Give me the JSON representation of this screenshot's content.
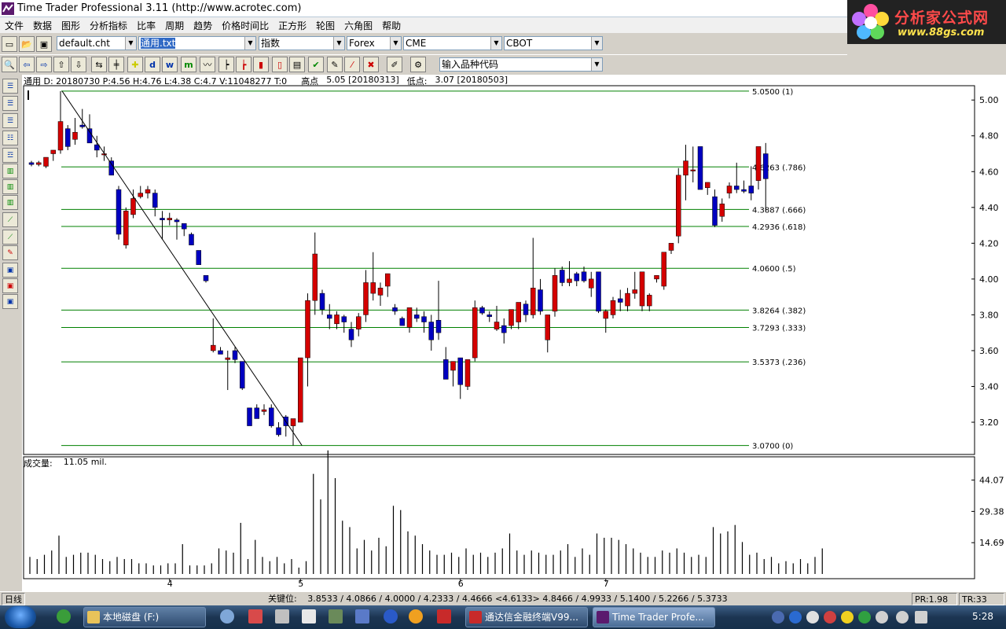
{
  "window": {
    "title": "Time Trader Professional 3.11 (http://www.acrotec.com)"
  },
  "logo": {
    "text": "分析家公式网",
    "url": "www.88gs.com"
  },
  "menu": [
    "文件",
    "数据",
    "图形",
    "分析指标",
    "比率",
    "周期",
    "趋势",
    "价格时间比",
    "正方形",
    "轮图",
    "六角图",
    "帮助"
  ],
  "toolbar": {
    "chart_file": "default.cht",
    "data_file": "通用.txt",
    "index": "指数",
    "market": "Forex",
    "exchange1": "CME",
    "exchange2": "CBOT",
    "symbol_placeholder": "输入品种代码"
  },
  "info": {
    "quote": "通用  D: 20180730  P:4.56  H:4.76  L:4.38  C:4.7  V:11048277  T:0",
    "high_label": "高点",
    "high_value": "5.05 [20180313]",
    "low_label": "低点:",
    "low_value": "3.07 [20180503]"
  },
  "volume": {
    "label": "成交量:",
    "value": "11.05 mil."
  },
  "status": {
    "period": "日线",
    "key_label": "关键位:",
    "key_values": "3.8533 / 4.0866 / 4.0000 / 4.2333 / 4.4666 <4.6133> 4.8466 / 4.9933 / 5.1400 / 5.2266 / 5.3733",
    "pr": "PR:1.98",
    "tr": "TR:33"
  },
  "taskbar": {
    "items": [
      "本地磁盘 (F:)",
      "通达信金融终端V99...",
      "Time Trader Profe..."
    ],
    "clock": "5:28"
  },
  "chart_data": {
    "type": "candlestick",
    "price_axis": {
      "ylim": [
        3.02,
        5.08
      ],
      "ticks": [
        "5.00",
        "4.80",
        "4.60",
        "4.40",
        "4.20",
        "4.00",
        "3.80",
        "3.60",
        "3.40",
        "3.20"
      ]
    },
    "volume_axis": {
      "ylim": [
        0,
        55
      ],
      "ticks": [
        "44.07",
        "29.38",
        "14.69"
      ]
    },
    "x_labels": [
      {
        "label": "4",
        "index": 19
      },
      {
        "label": "5",
        "index": 37
      },
      {
        "label": "6",
        "index": 59
      },
      {
        "label": "7",
        "index": 79
      }
    ],
    "fib_levels": [
      {
        "price": 5.05,
        "label": "5.0500  (1)"
      },
      {
        "price": 4.6263,
        "label": "4.6263  (.786)"
      },
      {
        "price": 4.3887,
        "label": "4.3887  (.666)"
      },
      {
        "price": 4.2936,
        "label": "4.2936  (.618)"
      },
      {
        "price": 4.06,
        "label": "4.0600  (.5)"
      },
      {
        "price": 3.8264,
        "label": "3.8264  (.382)"
      },
      {
        "price": 3.7293,
        "label": "3.7293  (.333)"
      },
      {
        "price": 3.5373,
        "label": "3.5373  (.236)"
      },
      {
        "price": 3.07,
        "label": "3.0700  (0)"
      }
    ],
    "trendline": {
      "from_index": 4,
      "from_price": 5.05,
      "to_index": 37,
      "to_price": 3.07
    },
    "candles": [
      [
        4.65,
        4.66,
        4.63,
        4.64
      ],
      [
        4.64,
        4.66,
        4.63,
        4.65
      ],
      [
        4.63,
        4.68,
        4.62,
        4.68
      ],
      [
        4.7,
        4.72,
        4.66,
        4.72
      ],
      [
        4.72,
        5.05,
        4.7,
        4.88
      ],
      [
        4.84,
        4.86,
        4.72,
        4.74
      ],
      [
        4.78,
        4.9,
        4.75,
        4.82
      ],
      [
        4.86,
        4.95,
        4.84,
        4.85
      ],
      [
        4.84,
        4.92,
        4.76,
        4.76
      ],
      [
        4.75,
        4.8,
        4.68,
        4.72
      ],
      [
        4.7,
        4.74,
        4.66,
        4.7
      ],
      [
        4.66,
        4.68,
        4.58,
        4.58
      ],
      [
        4.5,
        4.52,
        4.22,
        4.25
      ],
      [
        4.19,
        4.4,
        4.17,
        4.38
      ],
      [
        4.36,
        4.5,
        4.34,
        4.45
      ],
      [
        4.46,
        4.52,
        4.45,
        4.48
      ],
      [
        4.48,
        4.52,
        4.45,
        4.5
      ],
      [
        4.48,
        4.5,
        4.35,
        4.4
      ],
      [
        4.34,
        4.38,
        4.22,
        4.33
      ],
      [
        4.33,
        4.37,
        4.3,
        4.34
      ],
      [
        4.33,
        4.34,
        4.22,
        4.32
      ],
      [
        4.31,
        4.31,
        4.24,
        4.28
      ],
      [
        4.25,
        4.26,
        4.19,
        4.19
      ],
      [
        4.16,
        4.16,
        4.08,
        4.08
      ],
      [
        4.02,
        4.02,
        3.98,
        3.99
      ],
      [
        3.6,
        3.78,
        3.59,
        3.63
      ],
      [
        3.6,
        3.62,
        3.58,
        3.58
      ],
      [
        3.55,
        3.6,
        3.38,
        3.56
      ],
      [
        3.6,
        3.62,
        3.53,
        3.55
      ],
      [
        3.54,
        3.54,
        3.38,
        3.39
      ],
      [
        3.28,
        3.28,
        3.22,
        3.18
      ],
      [
        3.28,
        3.3,
        3.22,
        3.22
      ],
      [
        3.26,
        3.3,
        3.24,
        3.27
      ],
      [
        3.28,
        3.3,
        3.17,
        3.18
      ],
      [
        3.17,
        3.2,
        3.12,
        3.13
      ],
      [
        3.23,
        3.24,
        3.12,
        3.18
      ],
      [
        3.18,
        3.2,
        3.07,
        3.22
      ],
      [
        3.2,
        3.55,
        3.2,
        3.56
      ],
      [
        3.56,
        3.92,
        3.4,
        3.88
      ],
      [
        3.88,
        4.26,
        3.8,
        4.14
      ],
      [
        3.92,
        3.94,
        3.8,
        3.83
      ],
      [
        3.8,
        3.86,
        3.72,
        3.78
      ],
      [
        3.75,
        3.82,
        3.72,
        3.8
      ],
      [
        3.79,
        3.8,
        3.7,
        3.76
      ],
      [
        3.72,
        3.76,
        3.62,
        3.66
      ],
      [
        3.72,
        3.81,
        3.68,
        3.79
      ],
      [
        3.8,
        4.05,
        3.76,
        3.98
      ],
      [
        3.92,
        4.15,
        3.88,
        3.98
      ],
      [
        3.91,
        3.98,
        3.85,
        3.95
      ],
      [
        3.96,
        4.03,
        3.9,
        4.03
      ],
      [
        3.84,
        3.86,
        3.8,
        3.82
      ],
      [
        3.78,
        3.79,
        3.74,
        3.74
      ],
      [
        3.73,
        3.8,
        3.7,
        3.84
      ],
      [
        3.8,
        3.84,
        3.76,
        3.78
      ],
      [
        3.79,
        3.82,
        3.7,
        3.76
      ],
      [
        3.76,
        3.8,
        3.6,
        3.66
      ],
      [
        3.77,
        3.99,
        3.66,
        3.7
      ],
      [
        3.55,
        3.62,
        3.44,
        3.44
      ],
      [
        3.49,
        3.52,
        3.4,
        3.54
      ],
      [
        3.56,
        3.56,
        3.33,
        3.41
      ],
      [
        3.4,
        3.54,
        3.38,
        3.55
      ],
      [
        3.56,
        3.88,
        3.54,
        3.84
      ],
      [
        3.84,
        3.85,
        3.8,
        3.81
      ],
      [
        3.8,
        3.82,
        3.76,
        3.79
      ],
      [
        3.72,
        3.85,
        3.71,
        3.76
      ],
      [
        3.74,
        3.78,
        3.64,
        3.7
      ],
      [
        3.74,
        3.8,
        3.72,
        3.83
      ],
      [
        3.76,
        3.82,
        3.72,
        3.87
      ],
      [
        3.86,
        3.88,
        3.76,
        3.8
      ],
      [
        3.8,
        4.23,
        3.78,
        3.95
      ],
      [
        3.94,
        4.0,
        3.8,
        3.82
      ],
      [
        3.66,
        3.66,
        3.59,
        3.8
      ],
      [
        3.82,
        4.06,
        3.79,
        4.02
      ],
      [
        4.05,
        4.07,
        3.96,
        3.98
      ],
      [
        3.98,
        4.1,
        3.96,
        4.0
      ],
      [
        4.03,
        4.04,
        3.96,
        3.99
      ],
      [
        4.04,
        4.07,
        3.98,
        3.99
      ],
      [
        3.95,
        4.04,
        3.9,
        4.0
      ],
      [
        4.04,
        4.04,
        3.81,
        3.82
      ],
      [
        3.78,
        3.83,
        3.7,
        3.82
      ],
      [
        3.8,
        3.9,
        3.78,
        3.88
      ],
      [
        3.89,
        3.94,
        3.82,
        3.87
      ],
      [
        3.85,
        3.95,
        3.82,
        3.92
      ],
      [
        3.92,
        4.04,
        3.89,
        3.94
      ],
      [
        3.85,
        3.87,
        3.82,
        4.04
      ],
      [
        3.85,
        3.92,
        3.82,
        3.91
      ],
      [
        4.0,
        4.02,
        3.98,
        4.02
      ],
      [
        3.96,
        4.1,
        3.94,
        4.15
      ],
      [
        4.16,
        4.18,
        4.14,
        4.2
      ],
      [
        4.24,
        4.62,
        4.2,
        4.58
      ],
      [
        4.58,
        4.75,
        4.44,
        4.66
      ],
      [
        4.61,
        4.74,
        4.54,
        4.61
      ],
      [
        4.74,
        4.74,
        4.5,
        4.5
      ],
      [
        4.51,
        4.54,
        4.47,
        4.54
      ],
      [
        4.46,
        4.5,
        4.29,
        4.3
      ],
      [
        4.35,
        4.45,
        4.32,
        4.42
      ],
      [
        4.48,
        4.54,
        4.45,
        4.52
      ],
      [
        4.52,
        4.65,
        4.48,
        4.5
      ],
      [
        4.5,
        4.55,
        4.48,
        4.49
      ],
      [
        4.52,
        4.63,
        4.44,
        4.48
      ],
      [
        4.55,
        4.66,
        4.5,
        4.74
      ],
      [
        4.7,
        4.76,
        4.38,
        4.56
      ]
    ],
    "volumes": [
      8,
      7,
      9,
      11,
      18,
      8,
      9,
      10,
      10,
      9,
      7,
      6,
      8,
      7,
      7,
      5,
      5,
      4,
      4,
      5,
      5,
      14,
      4,
      4,
      4,
      5,
      12,
      11,
      10,
      24,
      7,
      16,
      8,
      6,
      8,
      5,
      7,
      3,
      6,
      47,
      35,
      58,
      45,
      25,
      22,
      12,
      16,
      11,
      17,
      13,
      32,
      30,
      20,
      18,
      14,
      11,
      9,
      9,
      10,
      8,
      12,
      9,
      10,
      8,
      10,
      12,
      19,
      11,
      9,
      11,
      10,
      9,
      9,
      11,
      14,
      8,
      12,
      9,
      19,
      17,
      17,
      16,
      14,
      12,
      10,
      8,
      8,
      11,
      10,
      12,
      10,
      8,
      9,
      8,
      22,
      19,
      20,
      23,
      15,
      9,
      10,
      7,
      8,
      5,
      6,
      5,
      7,
      5,
      8,
      12
    ]
  }
}
